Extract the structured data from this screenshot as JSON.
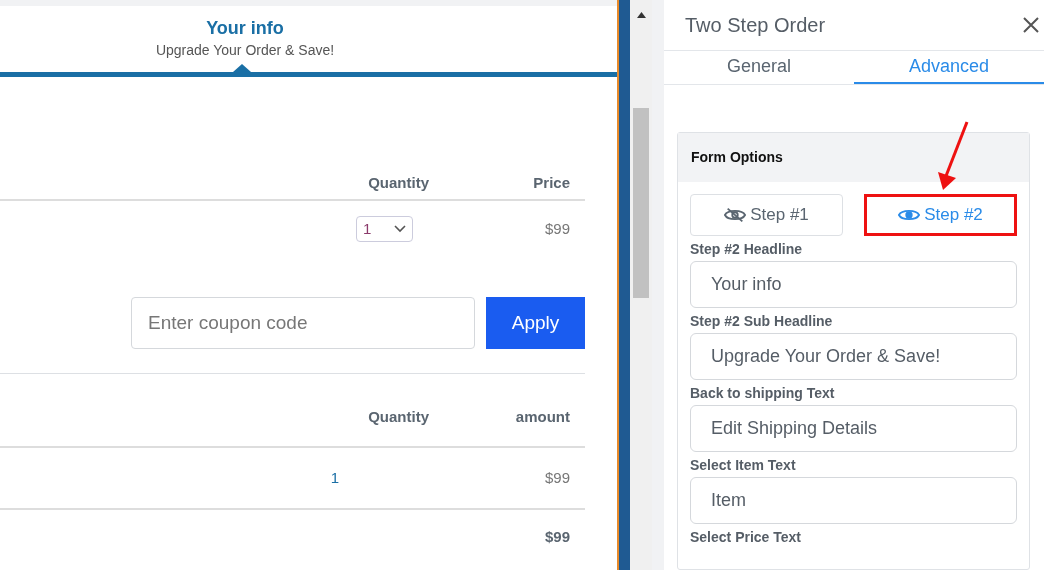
{
  "preview": {
    "step_title": "Your info",
    "step_subtitle": "Upgrade Your Order & Save!",
    "items_table": {
      "columns": [
        "Quantity",
        "Price"
      ],
      "rows": [
        {
          "quantity": "1",
          "price": "$99"
        }
      ]
    },
    "coupon": {
      "placeholder": "Enter coupon code",
      "button": "Apply"
    },
    "summary_table": {
      "columns": [
        "Quantity",
        "amount"
      ],
      "rows": [
        {
          "quantity": "1",
          "amount": "$99"
        }
      ],
      "total": "$99"
    }
  },
  "panel": {
    "title": "Two Step Order",
    "tabs": [
      {
        "label": "General",
        "selected": false
      },
      {
        "label": "Advanced",
        "selected": true
      }
    ],
    "section": {
      "title": "Form Options",
      "step_buttons": [
        {
          "label": "Step #1",
          "kind": "hidden",
          "selected": false,
          "highlighted": false
        },
        {
          "label": "Step #2",
          "kind": "visible",
          "selected": true,
          "highlighted": true
        }
      ],
      "fields": [
        {
          "label": "Step #2 Headline",
          "value": "Your info"
        },
        {
          "label": "Step #2 Sub Headline",
          "value": "Upgrade Your Order & Save!"
        },
        {
          "label": "Back to shipping Text",
          "value": "Edit Shipping Details"
        },
        {
          "label": "Select Item Text",
          "value": "Item"
        },
        {
          "label": "Select Price Text"
        }
      ]
    }
  }
}
